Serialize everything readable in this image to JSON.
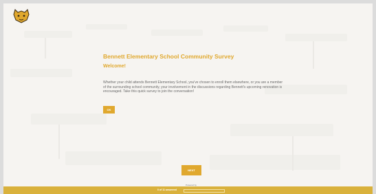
{
  "survey": {
    "title": "Bennett Elementary School Community Survey",
    "welcome": "Welcome!",
    "body": "Whether your child attends Bennett Elementary School, you've chosen to enroll them elsewhere, or you are a member of the surrounding school community, your involvement in the discussions regarding Bennett's upcoming renovation is encouraged. Take this quick survey to join the conversation!",
    "ok_label": "OK"
  },
  "nav": {
    "next_label": "NEXT"
  },
  "footer": {
    "powered_by": "Powered by",
    "progress_text": "0 of 11 answered",
    "progress_fraction": 0.0
  },
  "colors": {
    "accent": "#e0a82e",
    "footer_bar": "#d9b13c"
  },
  "icons": {
    "logo": "wildcat-logo-icon"
  }
}
